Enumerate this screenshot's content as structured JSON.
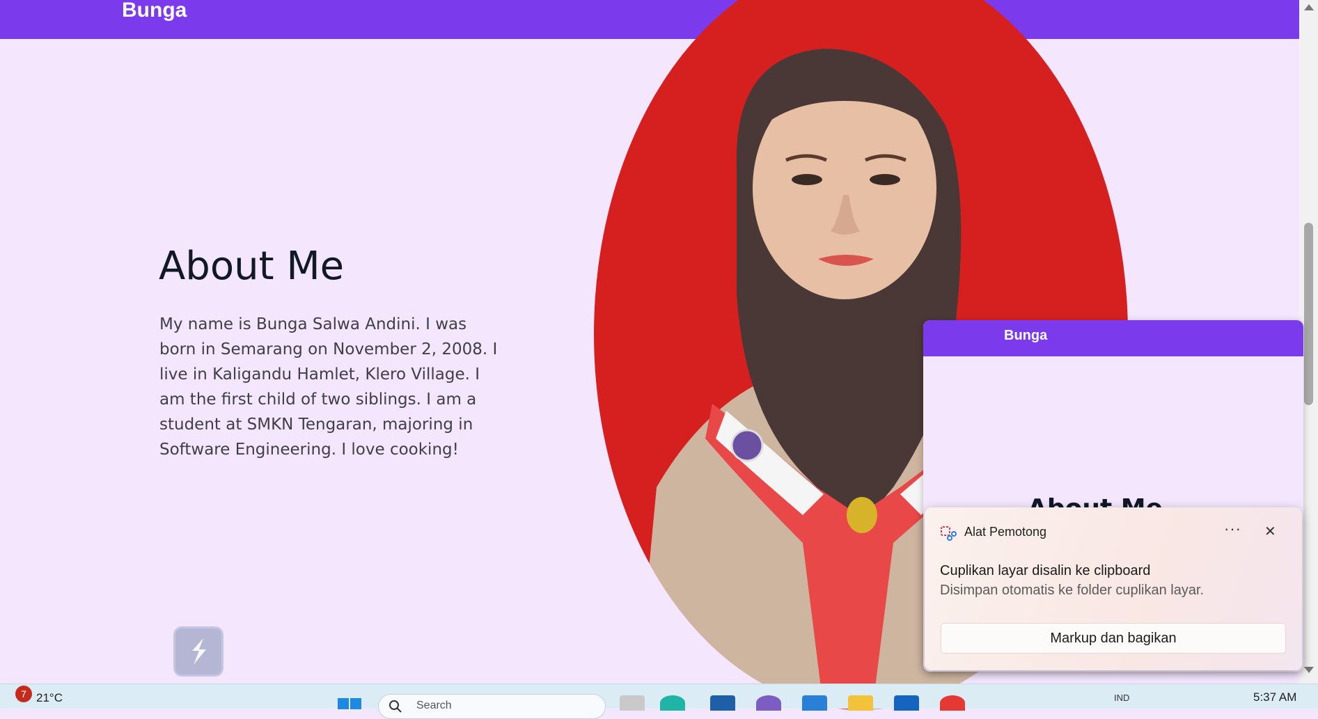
{
  "navbar": {
    "brand": "Bunga"
  },
  "about": {
    "title": "About Me",
    "text": "My name is Bunga Salwa Andini. I was born in Semarang on November 2, 2008. I live in Kaligandu Hamlet, Klero Village. I am the first child of two siblings. I am a student at SMKN Tengaran, majoring in Software Engineering. I love cooking!"
  },
  "preview": {
    "brand": "Bunga",
    "title": "About Me"
  },
  "toast": {
    "app_name": "Alat Pemotong",
    "more": "···",
    "close": "✕",
    "heading": "Cuplikan layar disalin ke clipboard",
    "subtext": "Disimpan otomatis ke folder cuplikan layar.",
    "button": "Markup dan bagikan"
  },
  "taskbar": {
    "weather_badge": "7",
    "temperature": "21°C",
    "search_placeholder": "Search",
    "lang": "IND",
    "clock": "5:37 AM"
  },
  "colors": {
    "navbar": "#7c3aed",
    "page_bg": "#f3e6fd",
    "portrait_bg": "#d62020"
  }
}
